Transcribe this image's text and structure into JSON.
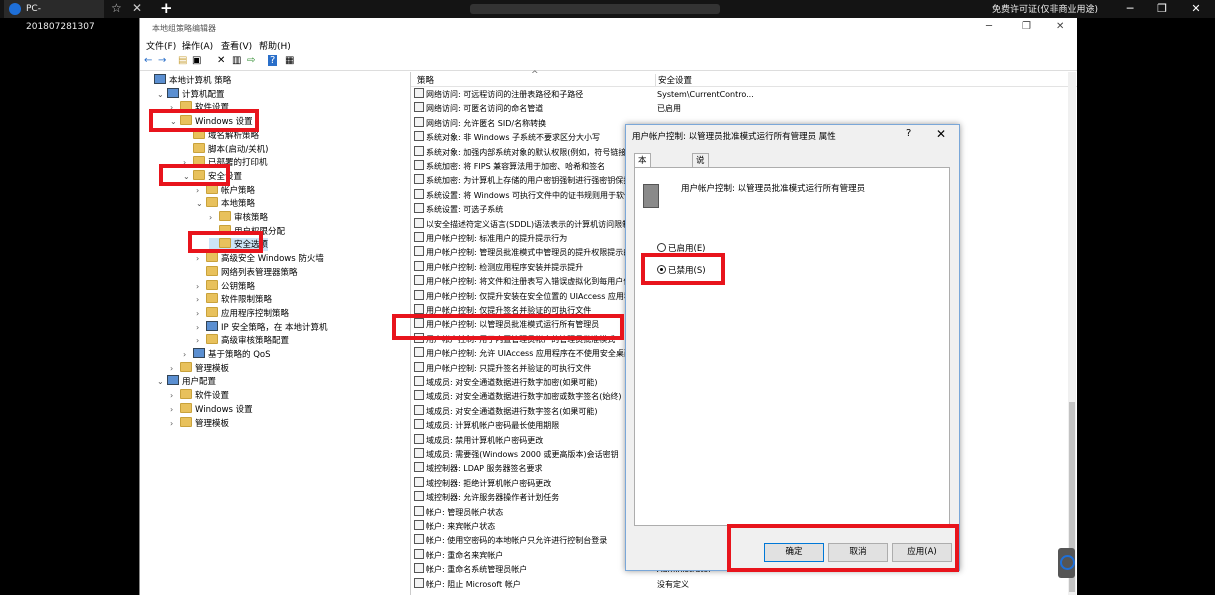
{
  "remote": {
    "tab_title": "PC-201807281307",
    "star": "☆",
    "close": "✕",
    "new_tab": "+",
    "license_text": "免费许可证(仅非商业用途)",
    "minimize": "─",
    "restore": "❐",
    "close_window": "✕"
  },
  "window": {
    "title": "本地组策略编辑器",
    "minimize": "─",
    "restore": "❐",
    "close": "✕"
  },
  "menu": [
    "文件(F)",
    "操作(A)",
    "查看(V)",
    "帮助(H)"
  ],
  "toolbar": [
    "←",
    "→",
    "▤",
    "▣",
    "✕",
    "▥",
    "⇨",
    "?",
    "▦"
  ],
  "tree": [
    {
      "label": "本地计算机 策略",
      "exp": "",
      "icon": "comp",
      "indent": 0
    },
    {
      "label": "计算机配置",
      "exp": "⌄",
      "icon": "comp",
      "indent": 1
    },
    {
      "label": "软件设置",
      "exp": "›",
      "icon": "fold",
      "indent": 2
    },
    {
      "label": "Windows 设置",
      "exp": "⌄",
      "icon": "fold",
      "indent": 2
    },
    {
      "label": "域名解析策略",
      "exp": "",
      "icon": "fold",
      "indent": 3
    },
    {
      "label": "脚本(启动/关机)",
      "exp": "",
      "icon": "fold",
      "indent": 3
    },
    {
      "label": "已部署的打印机",
      "exp": "›",
      "icon": "fold",
      "indent": 3
    },
    {
      "label": "安全设置",
      "exp": "⌄",
      "icon": "fold",
      "indent": 3
    },
    {
      "label": "帐户策略",
      "exp": "›",
      "icon": "fold",
      "indent": 4
    },
    {
      "label": "本地策略",
      "exp": "⌄",
      "icon": "fold",
      "indent": 4
    },
    {
      "label": "审核策略",
      "exp": "›",
      "icon": "fold",
      "indent": 5
    },
    {
      "label": "用户权限分配",
      "exp": "",
      "icon": "fold",
      "indent": 5
    },
    {
      "label": "安全选项",
      "exp": "",
      "icon": "fold",
      "indent": 5
    },
    {
      "label": "高级安全 Windows 防火墙",
      "exp": "›",
      "icon": "fold",
      "indent": 4
    },
    {
      "label": "网络列表管理器策略",
      "exp": "",
      "icon": "fold",
      "indent": 4
    },
    {
      "label": "公钥策略",
      "exp": "›",
      "icon": "fold",
      "indent": 4
    },
    {
      "label": "软件限制策略",
      "exp": "›",
      "icon": "fold",
      "indent": 4
    },
    {
      "label": "应用程序控制策略",
      "exp": "›",
      "icon": "fold",
      "indent": 4
    },
    {
      "label": "IP 安全策略，在 本地计算机",
      "exp": "›",
      "icon": "comp",
      "indent": 4
    },
    {
      "label": "高级审核策略配置",
      "exp": "›",
      "icon": "fold",
      "indent": 4
    },
    {
      "label": "基于策略的 QoS",
      "exp": "›",
      "icon": "comp",
      "indent": 3
    },
    {
      "label": "管理模板",
      "exp": "›",
      "icon": "fold",
      "indent": 2
    },
    {
      "label": "用户配置",
      "exp": "⌄",
      "icon": "comp",
      "indent": 1
    },
    {
      "label": "软件设置",
      "exp": "›",
      "icon": "fold",
      "indent": 2
    },
    {
      "label": "Windows 设置",
      "exp": "›",
      "icon": "fold",
      "indent": 2
    },
    {
      "label": "管理模板",
      "exp": "›",
      "icon": "fold",
      "indent": 2
    }
  ],
  "list": {
    "col_policy": "策略",
    "col_setting": "安全设置",
    "rows": [
      {
        "policy": "网络访问: 可远程访问的注册表路径和子路径",
        "value": "System\\CurrentContro..."
      },
      {
        "policy": "网络访问: 可匿名访问的命名管道",
        "value": "已启用"
      },
      {
        "policy": "网络访问: 允许匿名 SID/名称转换",
        "value": ""
      },
      {
        "policy": "系统对象: 非 Windows 子系统不要求区分大小写",
        "value": ""
      },
      {
        "policy": "系统对象: 加强内部系统对象的默认权限(例如，符号链接)",
        "value": ""
      },
      {
        "policy": "系统加密: 将 FIPS 兼容算法用于加密、哈希和签名",
        "value": ""
      },
      {
        "policy": "系统加密: 为计算机上存储的用户密钥强制进行强密钥保护",
        "value": ""
      },
      {
        "policy": "系统设置: 将 Windows 可执行文件中的证书规则用于软件限制策略",
        "value": ""
      },
      {
        "policy": "系统设置: 可选子系统",
        "value": ""
      },
      {
        "policy": "以安全描述符定义语言(SDDL)语法表示的计算机访问限制",
        "value": ""
      },
      {
        "policy": "用户帐户控制: 标准用户的提升提示行为",
        "value": ""
      },
      {
        "policy": "用户帐户控制: 管理员批准模式中管理员的提升权限提示的行为",
        "value": ""
      },
      {
        "policy": "用户帐户控制: 检测应用程序安装并提示提升",
        "value": ""
      },
      {
        "policy": "用户帐户控制: 将文件和注册表写入错误虚拟化到每用户位置",
        "value": ""
      },
      {
        "policy": "用户帐户控制: 仅提升安装在安全位置的 UIAccess 应用程序",
        "value": ""
      },
      {
        "policy": "用户帐户控制: 仅提升签名并验证的可执行文件",
        "value": ""
      },
      {
        "policy": "用户帐户控制: 以管理员批准模式运行所有管理员",
        "value": ""
      },
      {
        "policy": "用户帐户控制: 用于内置管理员帐户的管理员批准模式",
        "value": ""
      },
      {
        "policy": "用户帐户控制: 允许 UIAccess 应用程序在不使用安全桌面的情况下提升",
        "value": ""
      },
      {
        "policy": "用户帐户控制: 只提升签名并验证的可执行文件",
        "value": ""
      },
      {
        "policy": "域成员: 对安全通道数据进行数字加密(如果可能)",
        "value": ""
      },
      {
        "policy": "域成员: 对安全通道数据进行数字加密或数字签名(始终)",
        "value": ""
      },
      {
        "policy": "域成员: 对安全通道数据进行数字签名(如果可能)",
        "value": ""
      },
      {
        "policy": "域成员: 计算机帐户密码最长使用期限",
        "value": ""
      },
      {
        "policy": "域成员: 禁用计算机帐户密码更改",
        "value": ""
      },
      {
        "policy": "域成员: 需要强(Windows 2000 或更高版本)会话密钥",
        "value": ""
      },
      {
        "policy": "域控制器: LDAP 服务器签名要求",
        "value": ""
      },
      {
        "policy": "域控制器: 拒绝计算机帐户密码更改",
        "value": ""
      },
      {
        "policy": "域控制器: 允许服务器操作者计划任务",
        "value": ""
      },
      {
        "policy": "帐户: 管理员帐户状态",
        "value": ""
      },
      {
        "policy": "帐户: 来宾帐户状态",
        "value": ""
      },
      {
        "policy": "帐户: 使用空密码的本地帐户只允许进行控制台登录",
        "value": ""
      },
      {
        "policy": "帐户: 重命名来宾帐户",
        "value": ""
      },
      {
        "policy": "帐户: 重命名系统管理员帐户",
        "value": "Administrator"
      },
      {
        "policy": "帐户: 阻止 Microsoft 帐户",
        "value": "没有定义"
      }
    ]
  },
  "dialog": {
    "title": "用户帐户控制: 以管理员批准模式运行所有管理员 属性",
    "help": "?",
    "close": "✕",
    "tab_local": "本地安全设置",
    "tab_explain": "说明",
    "policy_name": "用户帐户控制: 以管理员批准模式运行所有管理员",
    "opt_enabled": "已启用(E)",
    "opt_disabled": "已禁用(S)",
    "selected": "disabled",
    "ok": "确定",
    "cancel": "取消",
    "apply": "应用(A)"
  }
}
